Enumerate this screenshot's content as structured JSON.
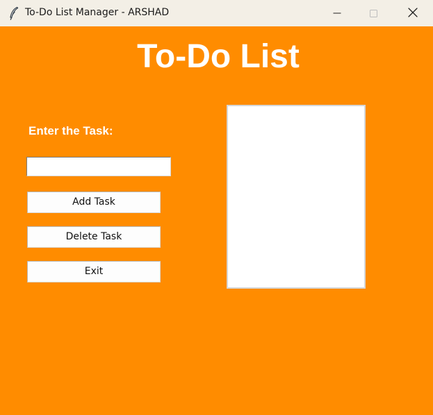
{
  "window": {
    "title": "To-Do List Manager - ARSHAD",
    "icons": {
      "app": "feather-icon",
      "minimize": "minimize-icon",
      "maximize": "maximize-icon",
      "close": "close-icon"
    }
  },
  "main": {
    "heading": "To-Do List",
    "task_label": "Enter the Task:",
    "task_input": {
      "value": "",
      "placeholder": ""
    },
    "buttons": {
      "add": "Add Task",
      "delete": "Delete Task",
      "exit": "Exit"
    },
    "tasks": []
  },
  "colors": {
    "background": "#ff8c00",
    "titlebar": "#f3efe6",
    "heading": "#ffffff",
    "button_background": "#fdfdfd",
    "listbox_background": "#ffffff"
  }
}
